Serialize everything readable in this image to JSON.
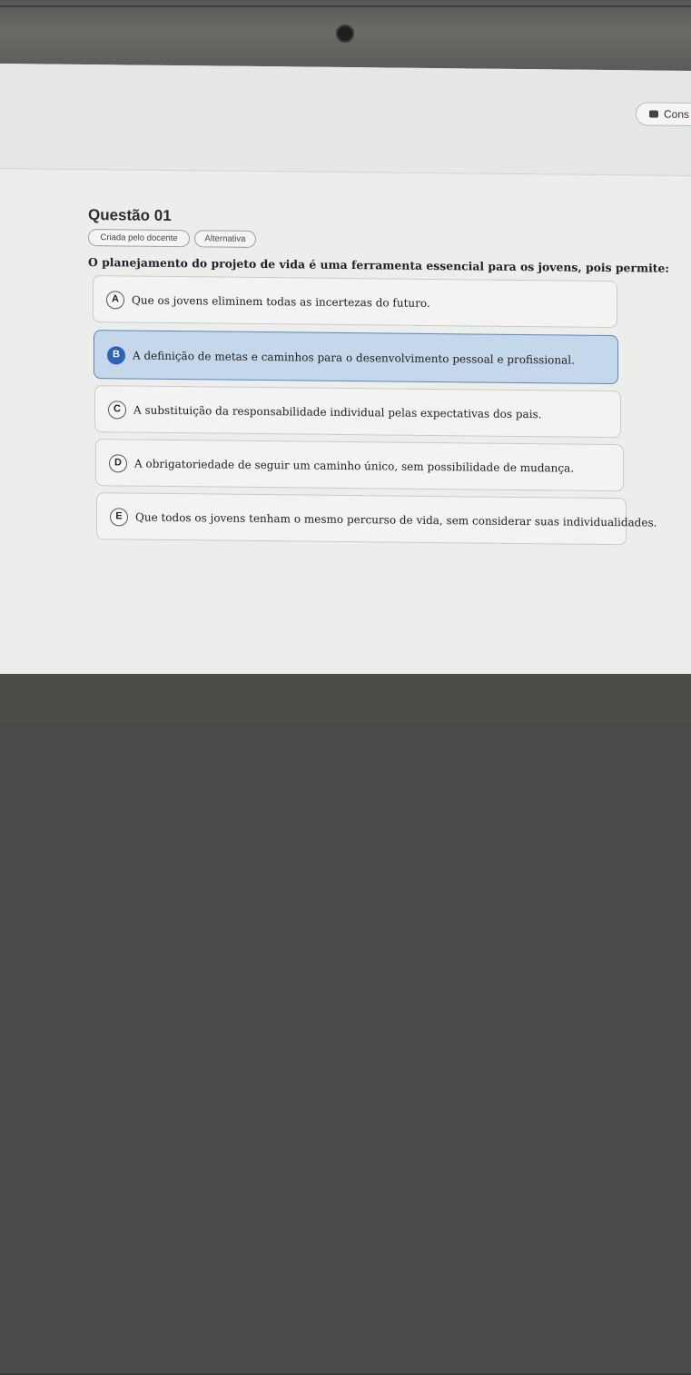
{
  "header": {
    "button_label": "Cons"
  },
  "question": {
    "title": "Questão 01",
    "tags": [
      "Criada pelo docente",
      "Alternativa"
    ],
    "stem": "O planejamento do projeto de vida é uma ferramenta essencial para os jovens, pois permite:",
    "options": [
      {
        "letter": "A",
        "text": "Que os jovens eliminem todas as incertezas do futuro.",
        "selected": false
      },
      {
        "letter": "B",
        "text": "A definição de metas e caminhos para o desenvolvimento pessoal e profissional.",
        "selected": true
      },
      {
        "letter": "C",
        "text": "A substituição da responsabilidade individual pelas expectativas dos pais.",
        "selected": false
      },
      {
        "letter": "D",
        "text": "A obrigatoriedade de seguir um caminho único, sem possibilidade de mudança.",
        "selected": false
      },
      {
        "letter": "E",
        "text": "Que todos os jovens tenham o mesmo percurso de vida, sem considerar suas individualidades.",
        "selected": false
      }
    ]
  }
}
